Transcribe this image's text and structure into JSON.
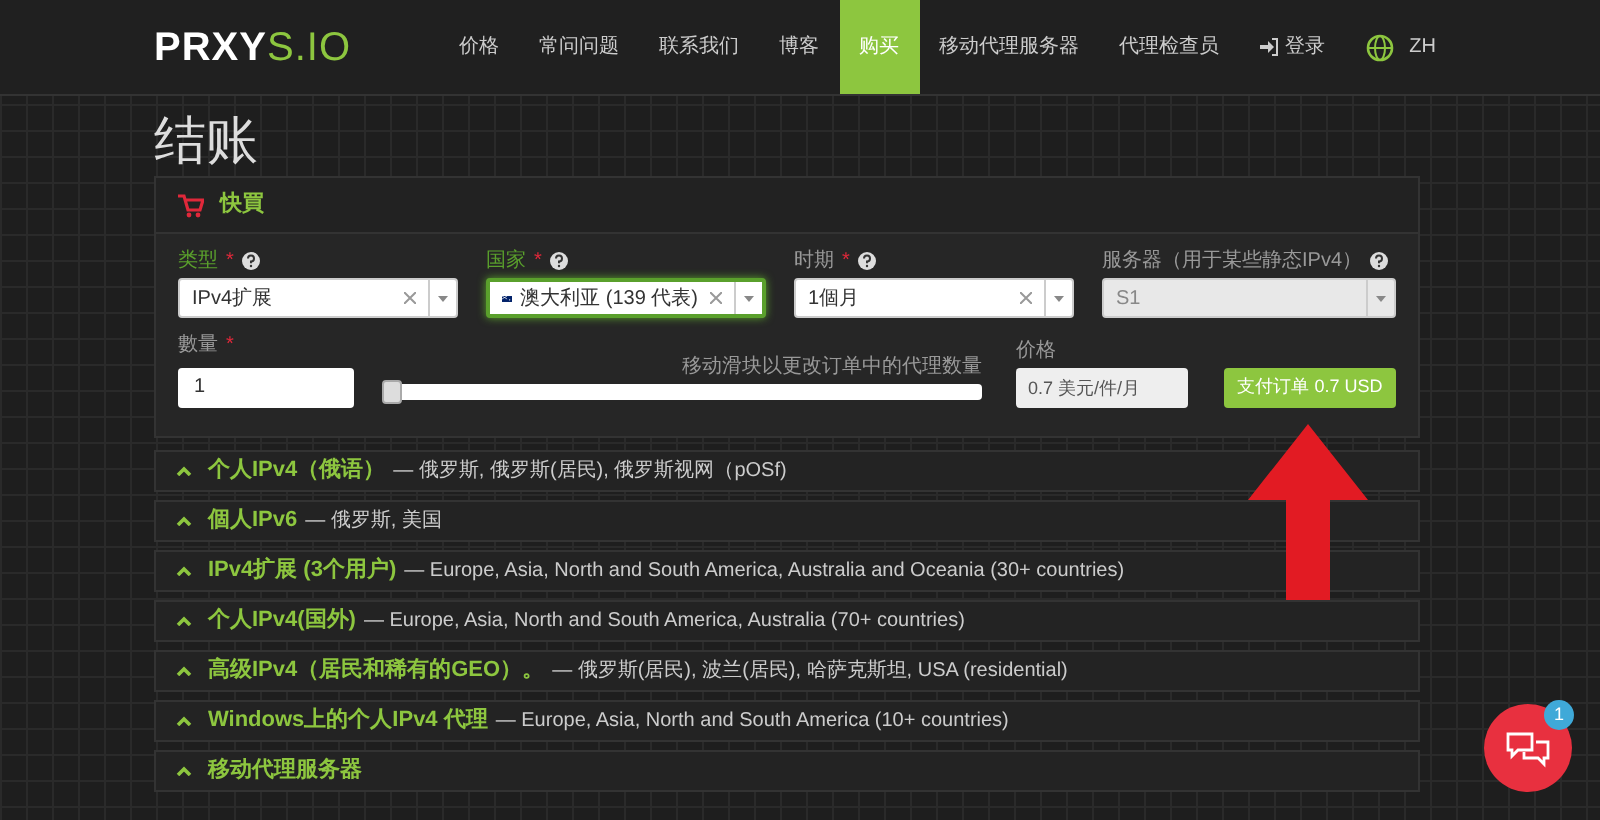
{
  "logo": {
    "text_dark": "PR",
    "text_mid": "XY",
    "text_end": "S.IO"
  },
  "nav": [
    {
      "label": "价格",
      "selected": false
    },
    {
      "label": "常问问题",
      "selected": false
    },
    {
      "label": "联系我们",
      "selected": false
    },
    {
      "label": "博客",
      "selected": false
    },
    {
      "label": "购买",
      "selected": true
    },
    {
      "label": "移动代理服务器",
      "selected": false
    },
    {
      "label": "代理检查员",
      "selected": false
    }
  ],
  "login": "登录",
  "language": "ZH",
  "page_title": "结账",
  "panel": {
    "title": "快買",
    "fields": [
      {
        "label": "类型",
        "required_mark": "*",
        "highlighted": true,
        "focused": false,
        "disabled": false,
        "value": "IPv4扩展",
        "flag": false,
        "clearable": true
      },
      {
        "label": "国家",
        "required_mark": "*",
        "highlighted": true,
        "focused": true,
        "disabled": false,
        "value": "澳大利亚 (139 代表)",
        "flag": true,
        "clearable": true
      },
      {
        "label": "时期",
        "required_mark": "*",
        "highlighted": false,
        "focused": false,
        "disabled": false,
        "value": "1個月",
        "flag": false,
        "clearable": true
      },
      {
        "label": "服务器（用于某些静态IPv4）",
        "highlighted": false,
        "focused": false,
        "disabled": true,
        "value": "S1",
        "flag": false,
        "clearable": false
      }
    ],
    "quantity": {
      "label": "數量",
      "required_mark": "*",
      "value": "1"
    },
    "slider": {
      "hint": "移动滑块以更改订单中的代理数量",
      "level": 0
    },
    "price": {
      "label": "价格",
      "value": "0.7 美元/件/月"
    },
    "pay_button": "支付订单 0.7 USD"
  },
  "sections": [
    {
      "title": "个人IPv4（俄语）",
      "description": "— 俄罗斯, 俄罗斯(居民), 俄罗斯视网（pOSf)"
    },
    {
      "title": "個人IPv6",
      "description": "— 俄罗斯, 美国"
    },
    {
      "title": "IPv4扩展 (3个用户)",
      "description": "— Europe, Asia, North and South America, Australia and Oceania (30+ countries)"
    },
    {
      "title": "个人IPv4(国外)",
      "description": "— Europe, Asia, North and South America, Australia (70+ countries)"
    },
    {
      "title": "高级IPv4（居民和稀有的GEO）。",
      "description": "— 俄罗斯(居民), 波兰(居民), 哈萨克斯坦, USA (residential)"
    },
    {
      "title": "Windows上的个人IPv4 代理",
      "description": "— Europe, Asia, North and South America (10+ countries)"
    },
    {
      "title": "移动代理服务器"
    }
  ],
  "chat": {
    "badge": "1"
  }
}
